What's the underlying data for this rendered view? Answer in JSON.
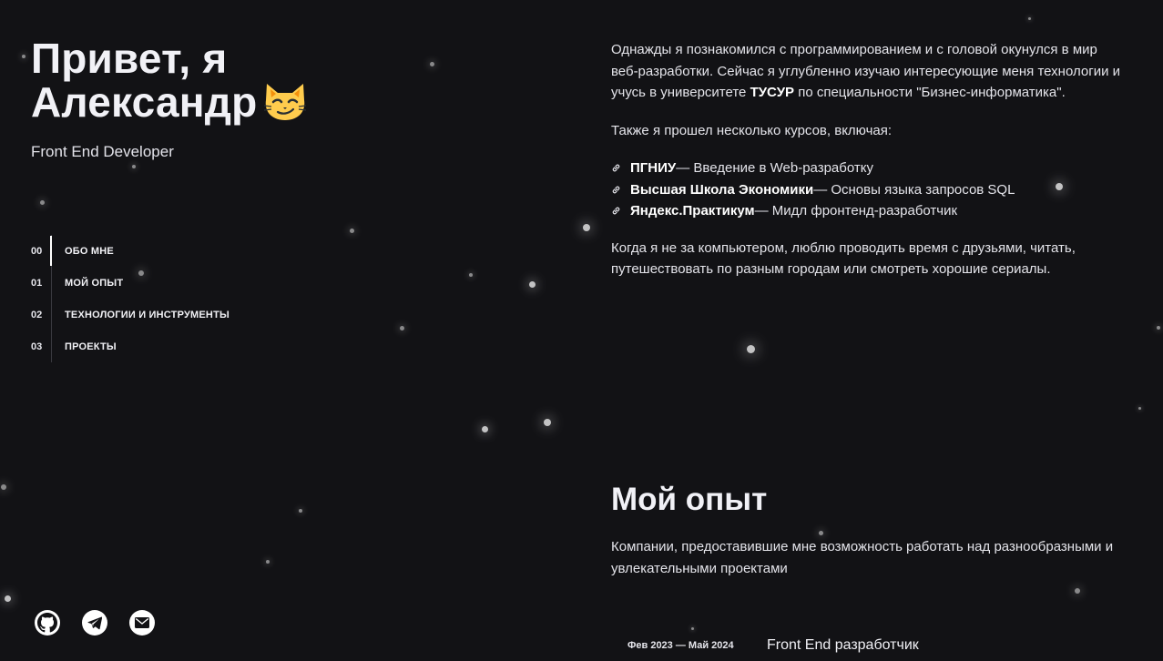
{
  "hero": {
    "title_line1": "Привет, я",
    "title_line2": "Александр",
    "emoji_icon": "smirking-cat-emoji",
    "subtitle": "Front End Developer"
  },
  "nav": {
    "active_index": 0,
    "items": [
      {
        "num": "00",
        "label": "ОБО МНЕ"
      },
      {
        "num": "01",
        "label": "МОЙ ОПЫТ"
      },
      {
        "num": "02",
        "label": "ТЕХНОЛОГИИ И ИНСТРУМЕНТЫ"
      },
      {
        "num": "03",
        "label": "ПРОЕКТЫ"
      }
    ]
  },
  "socials": [
    {
      "icon": "github-icon"
    },
    {
      "icon": "telegram-icon"
    },
    {
      "icon": "mail-icon"
    }
  ],
  "about": {
    "p1_a": "Однажды я познакомился с программированием и с головой окунулся в мир веб-разработки. Сейчас я углубленно изучаю интересующие меня технологии и учусь в университете ",
    "p1_university": "ТУСУР",
    "p1_b": " по специальности \"Бизнес-информатика\".",
    "p2": "Также я прошел несколько курсов, включая:",
    "courses": [
      {
        "name": "ПГНИУ",
        "desc": " — Введение в Web-разработку"
      },
      {
        "name": "Высшая Школа Экономики",
        "desc": " — Основы языка запросов SQL"
      },
      {
        "name": "Яндекс.Практикум",
        "desc": " — Мидл фронтенд-разработчик"
      }
    ],
    "p3": "Когда я не за компьютером, люблю проводить время с друзьями, читать, путешествовать по разным городам или смотреть хорошие сериалы."
  },
  "experience": {
    "title": "Мой опыт",
    "description": "Компании, предоставившие мне возможность работать над разнообразными и увлекательными проектами",
    "items": [
      {
        "period": "Фев 2023 — Май 2024",
        "role": "Front End разработчик"
      }
    ]
  },
  "colors": {
    "background": "#121215",
    "text": "#e4e4ea",
    "accent": "#ffffff",
    "emoji_fill": "#ffcc4d"
  }
}
